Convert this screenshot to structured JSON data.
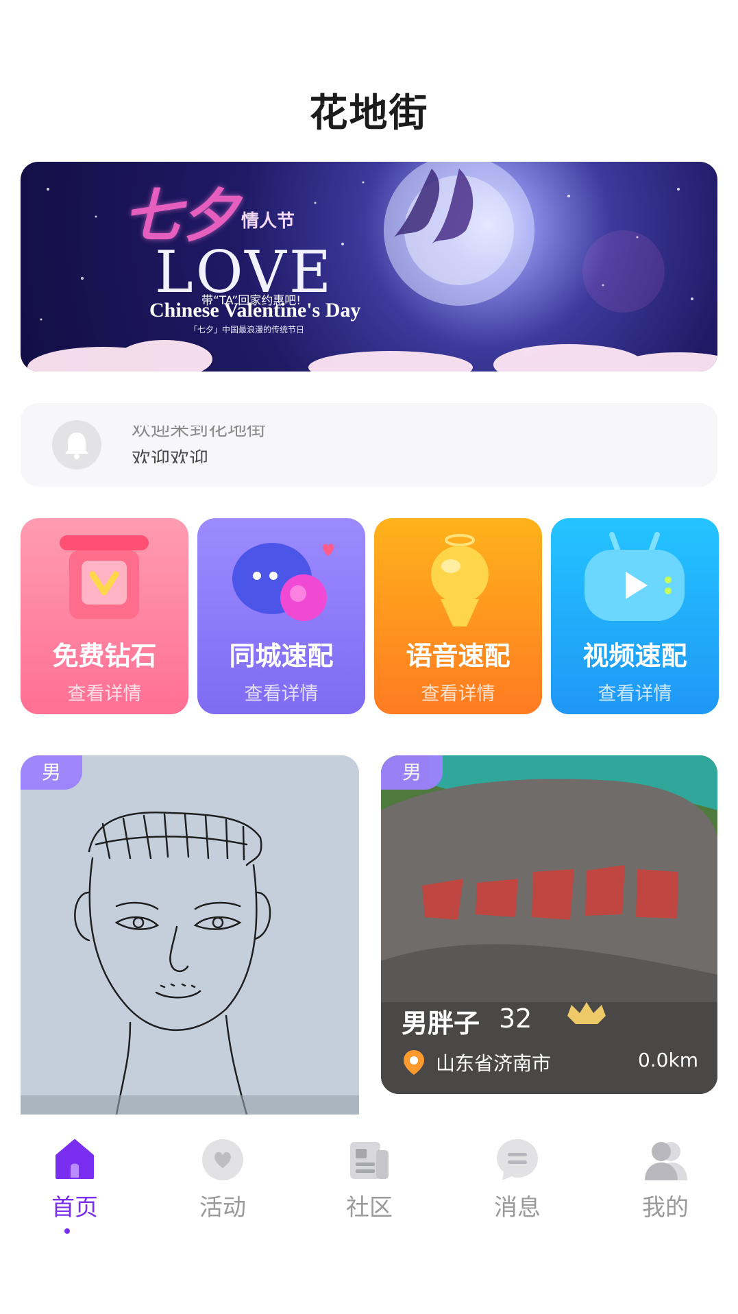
{
  "page": {
    "title": "花地街"
  },
  "banner": {
    "cn_title": "七夕",
    "cn_small": "情人节",
    "love": "LOVE",
    "tagline": "带“TA”回家约惠吧!",
    "en_title": "Chinese Valentine's Day",
    "subtitle": "「七夕」中国最浪漫的传统节日"
  },
  "notice": {
    "icon": "bell-icon",
    "line_1": "欢迎来到花地街",
    "line_2": "欢迎欢迎"
  },
  "features": [
    {
      "title": "免费钻石",
      "subtitle": "查看详情",
      "icon": "diamond-gift-icon",
      "color": "#ff7f9e"
    },
    {
      "title": "同城速配",
      "subtitle": "查看详情",
      "icon": "chat-bubbles-icon",
      "color": "#8a77f7"
    },
    {
      "title": "语音速配",
      "subtitle": "查看详情",
      "icon": "microphone-icon",
      "color": "#ff9520"
    },
    {
      "title": "视频速配",
      "subtitle": "查看详情",
      "icon": "video-tv-icon",
      "color": "#20b0fa"
    }
  ],
  "users": [
    {
      "gender": "男",
      "photo": "pencil-sketch-portrait"
    },
    {
      "gender": "男",
      "name": "男胖子",
      "age": "32",
      "location": "山东省济南市",
      "distance": "0.0km",
      "photo": "rock-carving-马上有对象"
    }
  ],
  "tabs": [
    {
      "label": "首页",
      "icon": "home-icon",
      "active": true
    },
    {
      "label": "活动",
      "icon": "heart-bubble-icon",
      "active": false
    },
    {
      "label": "社区",
      "icon": "news-icon",
      "active": false
    },
    {
      "label": "消息",
      "icon": "message-icon",
      "active": false
    },
    {
      "label": "我的",
      "icon": "profile-icon",
      "active": false
    }
  ],
  "colors": {
    "accent": "#7a2ff0",
    "gender_badge": "#9d82ff"
  }
}
